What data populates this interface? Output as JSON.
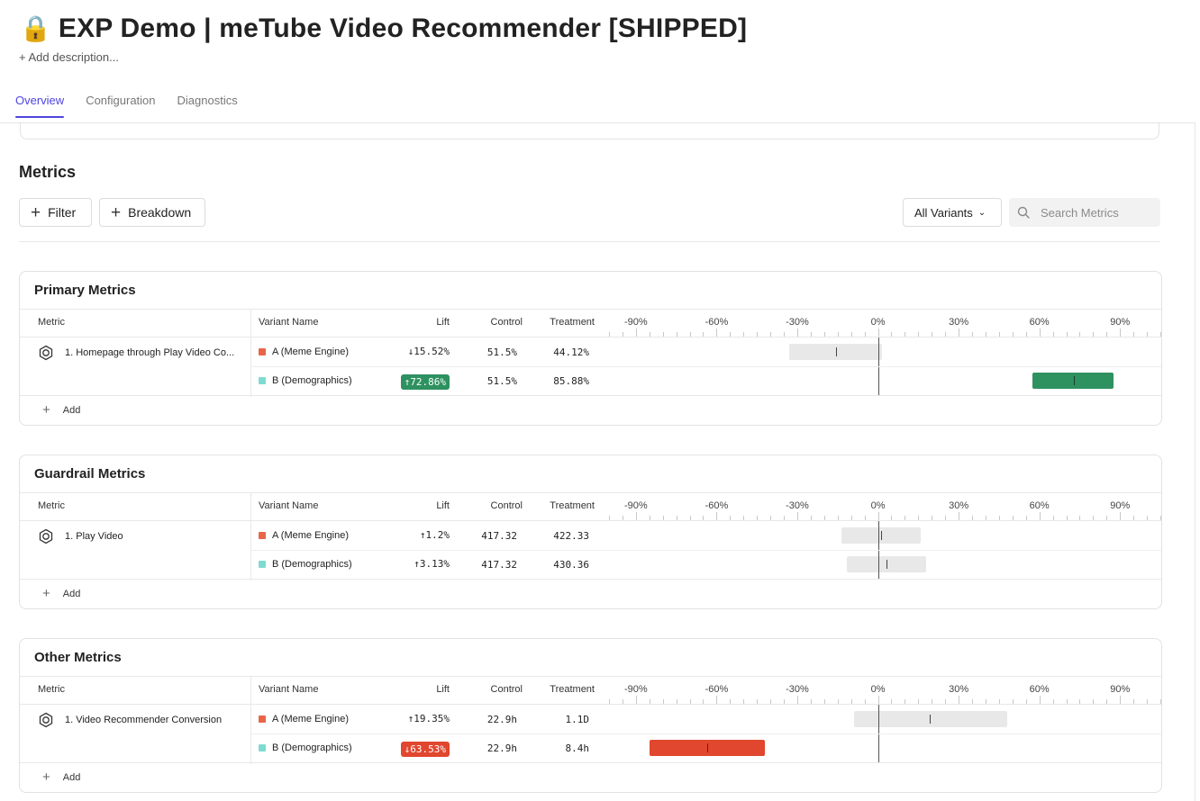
{
  "header": {
    "lock_icon": "🔒",
    "title": "EXP Demo | meTube Video Recommender [SHIPPED]",
    "add_description": "+ Add description..."
  },
  "tabs": [
    {
      "label": "Overview",
      "active": true
    },
    {
      "label": "Configuration",
      "active": false
    },
    {
      "label": "Diagnostics",
      "active": false
    }
  ],
  "metrics": {
    "heading": "Metrics",
    "filter_label": "Filter",
    "breakdown_label": "Breakdown",
    "variants_dropdown": "All Variants",
    "search_placeholder": "Search Metrics"
  },
  "columns": {
    "metric": "Metric",
    "variant_name": "Variant Name",
    "lift": "Lift",
    "control": "Control",
    "treatment": "Treatment"
  },
  "axis": {
    "ticks": [
      -90,
      -60,
      -30,
      0,
      30,
      60,
      90
    ],
    "tick_labels": [
      "-90%",
      "-60%",
      "-30%",
      "0%",
      "30%",
      "60%",
      "90%"
    ],
    "min": -100,
    "max": 105
  },
  "colors": {
    "accent": "#4f44e0",
    "variant_a": "#e8654a",
    "variant_b": "#7fdbd0",
    "positive": "#2e9160",
    "negative": "#e0472e",
    "neutral_bar": "#e8e8e8"
  },
  "add_label": "Add",
  "sections": [
    {
      "title": "Primary Metrics",
      "metric_name": "1. Homepage through Play Video Co...",
      "rows": [
        {
          "variant": "A (Meme Engine)",
          "lift": "↓15.52%",
          "lift_status": "neutral",
          "control": "51.5%",
          "treatment": "44.12%",
          "lift_value": -15.52,
          "ci_low": -33,
          "ci_high": 1.5
        },
        {
          "variant": "B (Demographics)",
          "lift": "↑72.86%",
          "lift_status": "positive",
          "control": "51.5%",
          "treatment": "85.88%",
          "lift_value": 72.86,
          "ci_low": 57.5,
          "ci_high": 87.5
        }
      ]
    },
    {
      "title": "Guardrail Metrics",
      "metric_name": "1. Play Video",
      "rows": [
        {
          "variant": "A (Meme Engine)",
          "lift": "↑1.2%",
          "lift_status": "neutral",
          "control": "417.32",
          "treatment": "422.33",
          "lift_value": 1.2,
          "ci_low": -13.5,
          "ci_high": 16.0
        },
        {
          "variant": "B (Demographics)",
          "lift": "↑3.13%",
          "lift_status": "neutral",
          "control": "417.32",
          "treatment": "430.36",
          "lift_value": 3.13,
          "ci_low": -11.5,
          "ci_high": 18.0
        }
      ]
    },
    {
      "title": "Other Metrics",
      "metric_name": "1. Video Recommender Conversion",
      "rows": [
        {
          "variant": "A (Meme Engine)",
          "lift": "↑19.35%",
          "lift_status": "neutral",
          "control": "22.9h",
          "treatment": "1.1D",
          "lift_value": 19.35,
          "ci_low": -9.0,
          "ci_high": 48.0
        },
        {
          "variant": "B (Demographics)",
          "lift": "↓63.53%",
          "lift_status": "negative",
          "control": "22.9h",
          "treatment": "8.4h",
          "lift_value": -63.53,
          "ci_low": -85.0,
          "ci_high": -42.0
        }
      ]
    }
  ]
}
